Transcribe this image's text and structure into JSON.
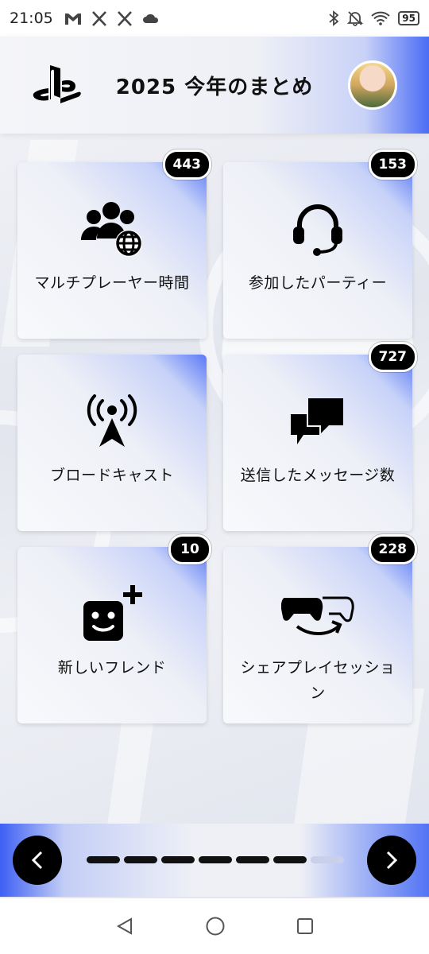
{
  "status_bar": {
    "time": "21:05",
    "battery": "95",
    "left_icons": [
      "gmail-icon",
      "x-icon",
      "x-icon",
      "cloud-icon"
    ],
    "right_icons": [
      "bluetooth-icon",
      "mute-icon",
      "wifi-icon",
      "battery-icon"
    ]
  },
  "header": {
    "title": "2025 今年のまとめ"
  },
  "cards": [
    {
      "label": "マルチプレーヤー時間",
      "badge": "443",
      "icon": "multiplayer-icon"
    },
    {
      "label": "参加したパーティー",
      "badge": "153",
      "icon": "headset-icon"
    },
    {
      "label": "ブロードキャスト",
      "badge": "",
      "icon": "broadcast-icon"
    },
    {
      "label": "送信したメッセージ数",
      "badge": "727",
      "icon": "messages-icon"
    },
    {
      "label": "新しいフレンド",
      "badge": "10",
      "icon": "add-friend-icon"
    },
    {
      "label": "シェアプレイセッション",
      "badge": "228",
      "icon": "share-play-icon"
    }
  ],
  "pagination": {
    "total": 7,
    "current": 6
  },
  "colors": {
    "accent": "#3d5ff3",
    "badge_bg": "#000000"
  }
}
